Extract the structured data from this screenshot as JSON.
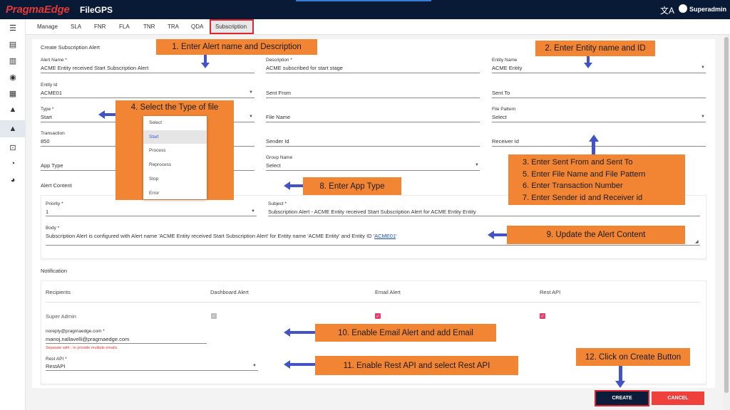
{
  "header": {
    "logo": "PragmaEdge",
    "app": "FileGPS",
    "user": "Superadmin"
  },
  "tabs": [
    "Manage",
    "SLA",
    "FNR",
    "FLA",
    "TNR",
    "TRA",
    "QDA",
    "Subscription"
  ],
  "form": {
    "title": "Create Subscription Alert",
    "alert_name_label": "Alert Name *",
    "alert_name": "ACME Entity received Start Subscription Alert",
    "description_label": "Description *",
    "description": "ACME subscribed for start stage",
    "entity_name_label": "Entity Name",
    "entity_name": "ACME Entity",
    "entity_id_label": "Entity Id",
    "entity_id": "ACME01",
    "sent_from": "Sent From",
    "sent_to": "Sent To",
    "type_label": "Type *",
    "type": "Start",
    "file_name": "File Name",
    "file_pattern_label": "File Pattern",
    "file_pattern": "Select",
    "transaction_label": "Transaction",
    "transaction": "850",
    "sender_id": "Sender Id",
    "receiver_id": "Receiver Id",
    "app_type": "App Type",
    "group_name_label": "Group Name",
    "group_name": "Select"
  },
  "type_options": [
    "Select",
    "Start",
    "Process",
    "Reprocess",
    "Stop",
    "Error"
  ],
  "alert_content": {
    "title": "Alert Content",
    "priority_label": "Priority *",
    "priority": "1",
    "subject_label": "Subject *",
    "subject": "Subscription Alert - ACME Entity received Start Subscription Alert for ACME Entity Entity",
    "body_label": "Body *",
    "body_text": "Subscription Alert is configured with Alert name 'ACME Entity received Start Subscription Alert' for Entity name 'ACME Entity' and Entity ID '",
    "body_link": "ACME01",
    "body_end": "'"
  },
  "notification": {
    "title": "Notification",
    "headers": [
      "Recipients",
      "Dashboard Alert",
      "Email Alert",
      "Rest API"
    ],
    "recipient": "Super Admin",
    "email_label": "noreply@pragmaedge.com *",
    "email": "manoj.nallavelli@pragmaedge.com",
    "email_hint": "Separate with ; to provide multiple emails.",
    "rest_label": "Rest API *",
    "rest_value": "RestAPI"
  },
  "buttons": {
    "create": "CREATE",
    "cancel": "CANCEL"
  },
  "annotations": {
    "a1": "1. Enter Alert name and Description",
    "a2": "2. Enter Entity name and ID",
    "a3": "3. Enter Sent From and Sent To",
    "a5": "5. Enter File Name and File Pattern",
    "a6": "6. Enter Transaction Number",
    "a7": "7. Enter Sender id and Receiver id",
    "a4": "4. Select the Type of file",
    "a8": "8. Enter App Type",
    "a9": "9. Update the Alert Content",
    "a10": "10. Enable Email Alert and add Email",
    "a11": "11. Enable Rest API and select Rest API",
    "a12": "12. Click on Create Button"
  },
  "colors": {
    "navbar": "#091a36",
    "annotation": "#f28534",
    "arrow": "#4254c5",
    "create": "#0b1d3a",
    "cancel": "#f0403c",
    "checkbox": "#e83e6e"
  }
}
